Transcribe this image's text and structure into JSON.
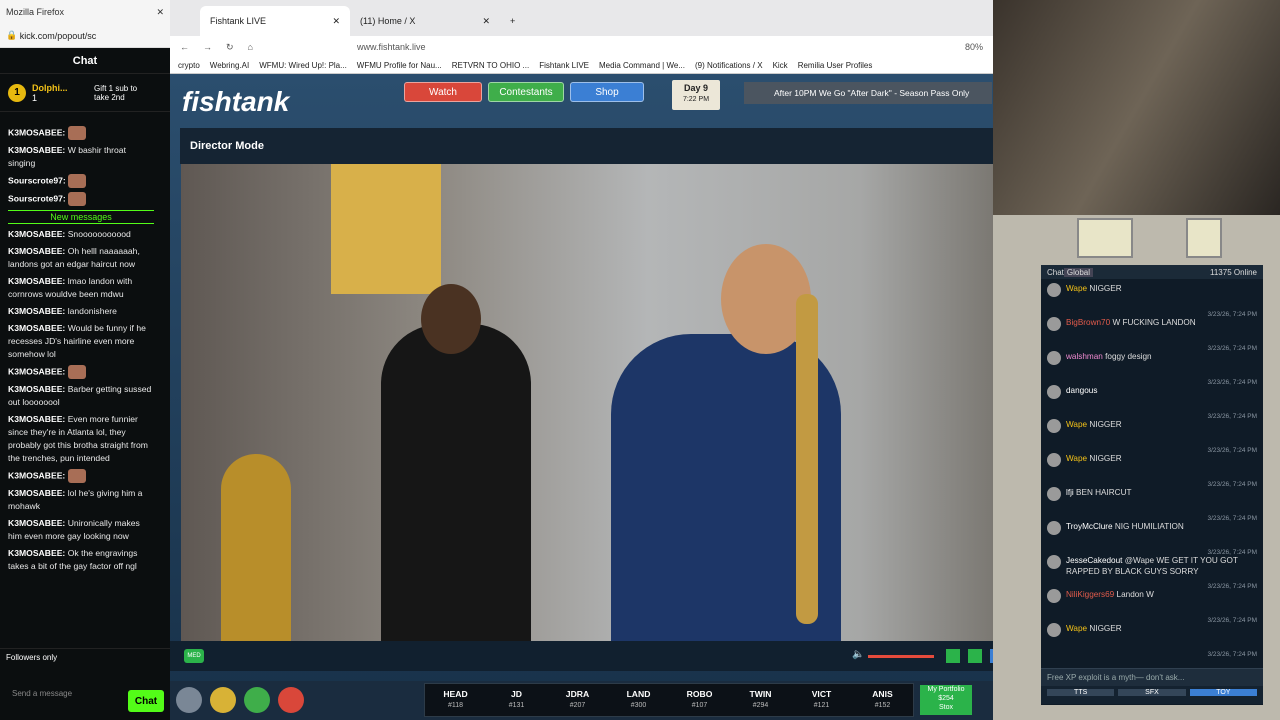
{
  "kick": {
    "window_title": "Mozilla Firefox",
    "url": "kick.com/popout/sc",
    "header": "Chat",
    "pinned": {
      "rank": "1",
      "user": "Dolphi...",
      "count": "1",
      "gift": "Gift 1 sub to take 2nd"
    },
    "new_messages_label": "New messages",
    "messages": [
      {
        "user": "K3MOSABEE:",
        "text": ""
      },
      {
        "user": "K3MOSABEE:",
        "text": "W bashir throat singing"
      },
      {
        "user": "Sourscrote97:",
        "text": ""
      },
      {
        "user": "Sourscrote97:",
        "text": ""
      },
      {
        "divider": true
      },
      {
        "user": "K3MOSABEE:",
        "text": "Snooooooooood"
      },
      {
        "user": "K3MOSABEE:",
        "text": "Oh helll naaaaaah, landons got an edgar haircut now"
      },
      {
        "user": "K3MOSABEE:",
        "text": "lmao landon with cornrows wouldve been mdwu"
      },
      {
        "user": "K3MOSABEE:",
        "text": "landonishere"
      },
      {
        "user": "K3MOSABEE:",
        "text": "Would be funny if he recesses JD's hairline even more somehow lol"
      },
      {
        "user": "K3MOSABEE:",
        "text": ""
      },
      {
        "user": "K3MOSABEE:",
        "text": "Barber getting sussed out loooooool"
      },
      {
        "user": "K3MOSABEE:",
        "text": "Even more funnier since they're in Atlanta lol, they probably got this brotha straight from the trenches, pun intended"
      },
      {
        "user": "K3MOSABEE:",
        "text": ""
      },
      {
        "user": "K3MOSABEE:",
        "text": "lol he's giving him a mohawk"
      },
      {
        "user": "K3MOSABEE:",
        "text": "Unironically makes him even more gay looking now"
      },
      {
        "user": "K3MOSABEE:",
        "text": "Ok the engravings takes a bit of the gay factor off ngl"
      }
    ],
    "followers_only": "Followers only",
    "send_placeholder": "Send a message",
    "chat_button": "Chat"
  },
  "browser": {
    "tabs": [
      {
        "label": "Fishtank LIVE"
      },
      {
        "label": "(11) Home / X"
      }
    ],
    "url": "www.fishtank.live",
    "zoom": "80%",
    "bookmarks": [
      "crypto",
      "Webring.AI",
      "WFMU: Wired Up!: Pla...",
      "WFMU Profile for Nau...",
      "RETVRN TO OHIO ...",
      "Fishtank LIVE",
      "Media Command | We...",
      "(9) Notifications / X",
      "Kick",
      "Remilia User Profiles"
    ]
  },
  "site": {
    "logo": "fishtank",
    "buttons": [
      {
        "label": "Watch",
        "color": "#d9473a"
      },
      {
        "label": "Contestants",
        "color": "#3fae4a"
      },
      {
        "label": "Shop",
        "color": "#3b7fd4"
      }
    ],
    "day": "Day 9",
    "time": "7:22 PM",
    "announcement": "After 10PM We Go \"After Dark\" - Season Pass Only",
    "director_mode": "Director Mode",
    "quality": "MED",
    "cameras": [
      {
        "name": "HEAD",
        "count": "#118"
      },
      {
        "name": "JD",
        "count": "#131"
      },
      {
        "name": "JDRA",
        "count": "#207"
      },
      {
        "name": "LAND",
        "count": "#300"
      },
      {
        "name": "ROBO",
        "count": "#107"
      },
      {
        "name": "TWIN",
        "count": "#294"
      },
      {
        "name": "VICT",
        "count": "#121"
      },
      {
        "name": "ANIS",
        "count": "#152"
      }
    ],
    "portfolio": {
      "label": "My Portfolio",
      "value": "$254",
      "stox": "Stox"
    }
  },
  "chat2": {
    "tab": "Chat",
    "scope": "Global",
    "online": "11375 Online",
    "input_placeholder": "Free XP exploit is a myth— don't ask...",
    "footer": [
      "TTS",
      "SFX",
      "TOY"
    ],
    "messages": [
      {
        "user": "Wape",
        "text": "NIGGER",
        "ts": "3/23/26, 7:24 PM"
      },
      {
        "user": "BigBrown70",
        "text": "W FUCKING LANDON",
        "ts": "3/23/26, 7:24 PM"
      },
      {
        "user": "walshman",
        "text": "foggy design",
        "ts": "3/23/26, 7:24 PM"
      },
      {
        "user": "dangous",
        "text": "",
        "ts": "3/23/26, 7:24 PM"
      },
      {
        "user": "Wape",
        "text": "NIGGER",
        "ts": "3/23/26, 7:24 PM"
      },
      {
        "user": "Wape",
        "text": "NIGGER",
        "ts": "3/23/26, 7:24 PM"
      },
      {
        "user": "lfji",
        "text": "BEN HAIRCUT",
        "ts": "3/23/26, 7:24 PM"
      },
      {
        "user": "TroyMcClure",
        "text": "NIG HUMILIATION",
        "ts": "3/23/26, 7:24 PM"
      },
      {
        "user": "JesseCakedout",
        "text": "@Wape WE GET IT YOU GOT RAPPED BY BLACK GUYS SORRY",
        "ts": "3/23/26, 7:24 PM"
      },
      {
        "user": "NiliKiggers69",
        "text": "Landon W",
        "ts": "3/23/26, 7:24 PM"
      },
      {
        "user": "Wape",
        "text": "NIGGER",
        "ts": "3/23/26, 7:24 PM"
      }
    ]
  }
}
